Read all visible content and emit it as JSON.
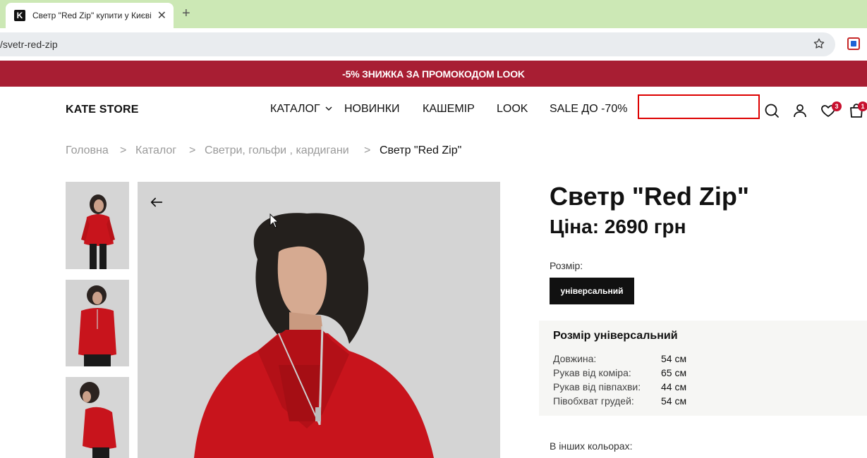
{
  "browser": {
    "tab_title": "Светр \"Red Zip\" купити у Києві",
    "favicon_letter": "K",
    "url": "/svetr-red-zip"
  },
  "promo": {
    "text": "-5% ЗНИЖКА ЗА ПРОМОКОДОМ LOOK"
  },
  "header": {
    "logo": "KATE STORE",
    "nav": [
      "КАТАЛОГ",
      "НОВИНКИ",
      "КАШЕМІР",
      "LOOK",
      "SALE ДО -70%"
    ],
    "search_value": "",
    "wishlist_count": "3",
    "cart_count": "1"
  },
  "breadcrumb": {
    "items": [
      "Головна",
      "Каталог",
      "Светри, гольфи , кардигани",
      "Светр \"Red Zip\""
    ],
    "separator": ">"
  },
  "product": {
    "title": "Светр \"Red Zip\"",
    "price": "Ціна: 2690 грн",
    "size_label": "Розмір:",
    "size_option": "універсальний",
    "size_box_title": "Розмір універсальний",
    "measurements": [
      {
        "label": "Довжина:",
        "value": "54 см"
      },
      {
        "label": "Рукав від коміра:",
        "value": "65 см"
      },
      {
        "label": "Рукав від півпахви:",
        "value": "44 см"
      },
      {
        "label": "Півобхват грудей:",
        "value": "54 см"
      }
    ],
    "other_colors_label": "В інших кольорах:"
  },
  "colors": {
    "promo_bg": "#a81e33",
    "accent_red": "#c8102e",
    "sweater_red": "#c8141c"
  }
}
